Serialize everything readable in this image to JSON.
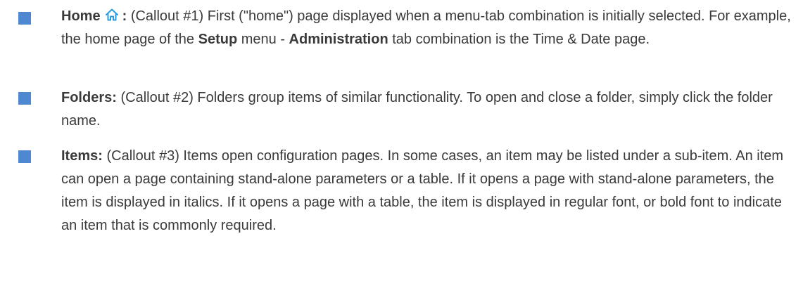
{
  "colors": {
    "bullet": "#4d88d1",
    "text": "#3a3a3a",
    "icon": "#2b9be0"
  },
  "items": [
    {
      "term": "Home",
      "icon": "home-icon",
      "colon": ":",
      "callout": "(Callout #1) First (\"home\") page displayed when a menu-tab combination is initially selected. For example, the home page of the",
      "setup_word": "Setup",
      "menu_dash": "menu -",
      "admin_word": "Administration",
      "tail": "tab combination is the Time & Date page."
    },
    {
      "term": "Folders:",
      "text": "(Callout #2) Folders group items of similar functionality. To open and close a folder, simply click the folder name."
    },
    {
      "term": "Items:",
      "text": "(Callout #3) Items open configuration pages. In some cases, an item may be listed under a sub-item. An item can open a page containing stand-alone parameters or a table. If it opens a page with stand-alone parameters, the item is displayed in italics. If it opens a page with a table, the item is displayed in regular font, or bold font to indicate an item that is commonly required."
    }
  ]
}
